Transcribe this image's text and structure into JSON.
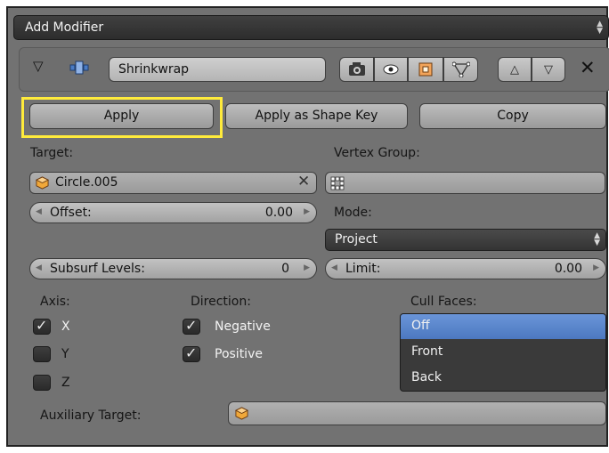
{
  "menu": {
    "title": "Add Modifier"
  },
  "modifier": {
    "name": "Shrinkwrap",
    "toggle_icons": [
      "camera-icon",
      "eye-icon",
      "edit-mode-icon",
      "cage-icon"
    ],
    "move_icons": [
      "move-up-icon",
      "move-down-icon"
    ],
    "close_icon": "close-icon"
  },
  "actions": {
    "apply": "Apply",
    "apply_shape": "Apply as Shape Key",
    "copy": "Copy"
  },
  "highlight_color": "#ffeb3b",
  "target": {
    "label": "Target:",
    "value": "Circle.005"
  },
  "vertex_group": {
    "label": "Vertex Group:"
  },
  "offset": {
    "label": "Offset:",
    "value": "0.00"
  },
  "mode": {
    "label": "Mode:",
    "value": "Project"
  },
  "subsurf": {
    "label": "Subsurf Levels:",
    "value": "0"
  },
  "limit": {
    "label": "Limit:",
    "value": "0.00"
  },
  "axis": {
    "label": "Axis:",
    "items": [
      {
        "label": "X",
        "checked": true
      },
      {
        "label": "Y",
        "checked": false
      },
      {
        "label": "Z",
        "checked": false
      }
    ]
  },
  "direction": {
    "label": "Direction:",
    "items": [
      {
        "label": "Negative",
        "checked": true
      },
      {
        "label": "Positive",
        "checked": true
      }
    ]
  },
  "cull_faces": {
    "label": "Cull Faces:",
    "options": [
      "Off",
      "Front",
      "Back"
    ],
    "selected": "Off",
    "selected_color": "#5680c2"
  },
  "auxiliary": {
    "label": "Auxiliary Target:"
  }
}
